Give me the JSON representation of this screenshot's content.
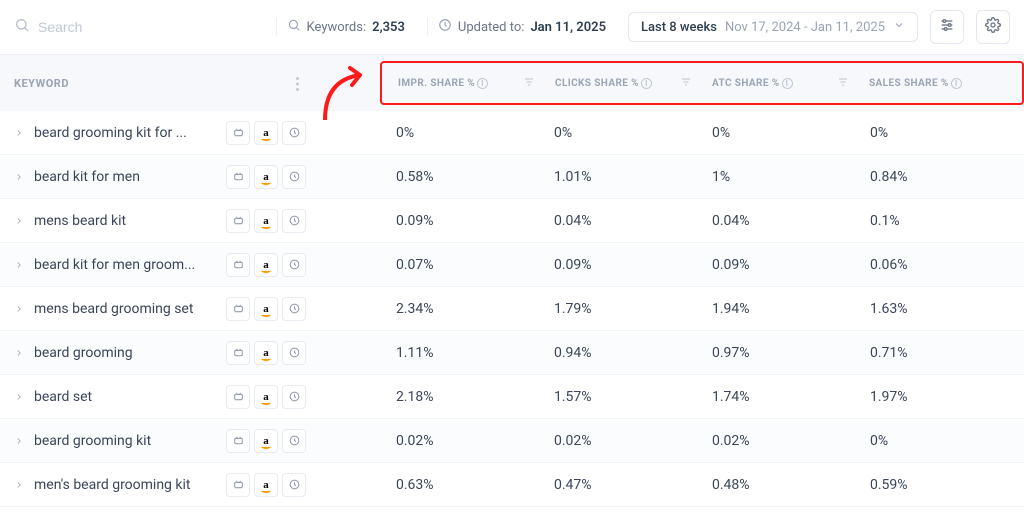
{
  "topbar": {
    "search_placeholder": "Search",
    "keywords_label": "Keywords:",
    "keywords_count": "2,353",
    "updated_label": "Updated to:",
    "updated_date": "Jan 11, 2025",
    "range_label": "Last 8 weeks",
    "range_dates": "Nov 17, 2024 - Jan 11, 2025"
  },
  "columns": {
    "keyword": "Keyword",
    "impr": "Impr. Share %",
    "clicks": "Clicks Share %",
    "atc": "ATC Share %",
    "sales": "Sales Share %"
  },
  "rows": [
    {
      "kw": "beard grooming kit for ...",
      "impr": "0%",
      "clicks": "0%",
      "atc": "0%",
      "sales": "0%"
    },
    {
      "kw": "beard kit for men",
      "impr": "0.58%",
      "clicks": "1.01%",
      "atc": "1%",
      "sales": "0.84%"
    },
    {
      "kw": "mens beard kit",
      "impr": "0.09%",
      "clicks": "0.04%",
      "atc": "0.04%",
      "sales": "0.1%"
    },
    {
      "kw": "beard kit for men groom...",
      "impr": "0.07%",
      "clicks": "0.09%",
      "atc": "0.09%",
      "sales": "0.06%"
    },
    {
      "kw": "mens beard grooming set",
      "impr": "2.34%",
      "clicks": "1.79%",
      "atc": "1.94%",
      "sales": "1.63%"
    },
    {
      "kw": "beard grooming",
      "impr": "1.11%",
      "clicks": "0.94%",
      "atc": "0.97%",
      "sales": "0.71%"
    },
    {
      "kw": "beard set",
      "impr": "2.18%",
      "clicks": "1.57%",
      "atc": "1.74%",
      "sales": "1.97%"
    },
    {
      "kw": "beard grooming kit",
      "impr": "0.02%",
      "clicks": "0.02%",
      "atc": "0.02%",
      "sales": "0%"
    },
    {
      "kw": "men's beard grooming kit",
      "impr": "0.63%",
      "clicks": "0.47%",
      "atc": "0.48%",
      "sales": "0.59%"
    }
  ]
}
